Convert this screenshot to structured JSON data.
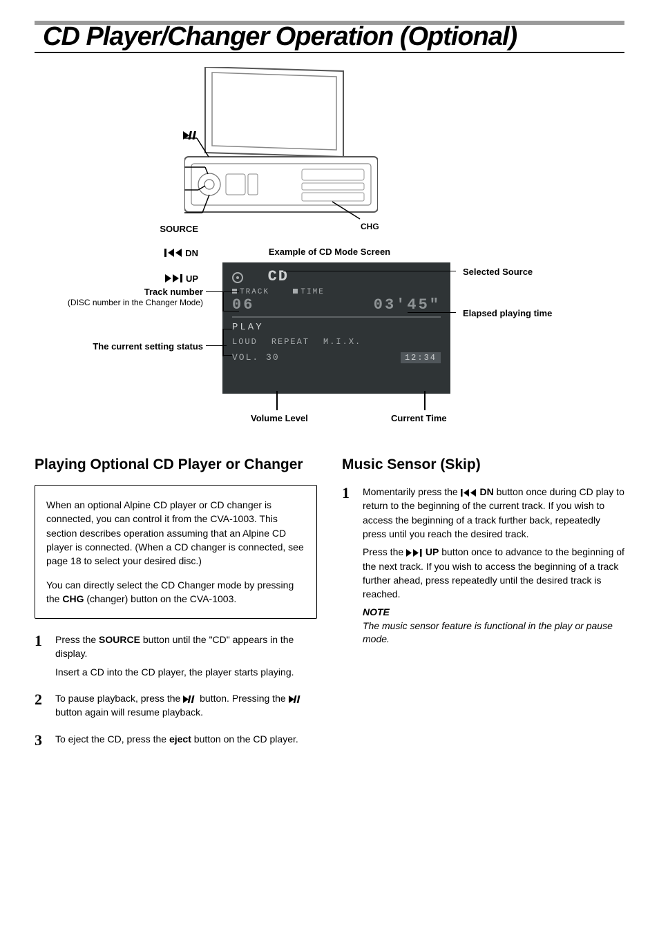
{
  "title": "CD Player/Changer Operation (Optional)",
  "device_labels": {
    "play_pause": "",
    "source": "SOURCE",
    "dn": "DN",
    "up": "UP",
    "chg": "CHG"
  },
  "example_caption": "Example of CD Mode Screen",
  "screen": {
    "source_label": "CD",
    "track_label": "TRACK",
    "time_label": "TIME",
    "track_value": "06",
    "elapsed_value": "03'45\"",
    "play_status": "PLAY",
    "loud": "LOUD",
    "repeat": "REPEAT",
    "mix": "M.I.X.",
    "vol_label": "VOL.",
    "vol_value": "30",
    "clock": "12:34"
  },
  "callouts": {
    "selected_source": "Selected Source",
    "track_number": "Track number",
    "track_number_sub": "(DISC number in the Changer Mode)",
    "elapsed": "Elapsed playing time",
    "setting_status": "The current setting status",
    "volume_level": "Volume Level",
    "current_time": "Current Time"
  },
  "left_section": {
    "heading": "Playing Optional CD Player or Changer",
    "intro_p1_a": "When an optional Alpine CD player or CD changer is connected, you can control it from the CVA-1003. This section describes operation assuming that an Alpine CD player is connected. (When a CD changer is connected, see page 18 to select your desired disc.)",
    "intro_p2_a": "You can directly select the CD Changer mode by pressing the ",
    "intro_p2_chg": "CHG",
    "intro_p2_b": " (changer) button on the CVA-1003.",
    "step1_a": "Press the ",
    "step1_source": "SOURCE",
    "step1_b": " button until the \"CD\" appears in the display.",
    "step1_c": "Insert a CD into the CD player, the player starts playing.",
    "step2_a": "To pause playback, press the ",
    "step2_b": " button. Pressing the ",
    "step2_c": " button again will resume playback.",
    "step3_a": "To eject the CD, press the ",
    "step3_eject": "eject",
    "step3_b": " button on the CD player."
  },
  "right_section": {
    "heading": "Music Sensor (Skip)",
    "step1_a": "Momentarily press the ",
    "step1_dn": " DN",
    "step1_b": " button once during CD play to return to the beginning of the current track. If you wish to access the beginning of a track further back, repeatedly press until you reach the desired track.",
    "step1_p2_a": "Press the ",
    "step1_up": " UP",
    "step1_p2_b": " button once to advance to the beginning of the next track. If you wish to access the beginning of a track further ahead, press repeatedly until the desired track is reached.",
    "note_head": "NOTE",
    "note_body": "The music sensor feature is functional in the play or pause mode."
  }
}
